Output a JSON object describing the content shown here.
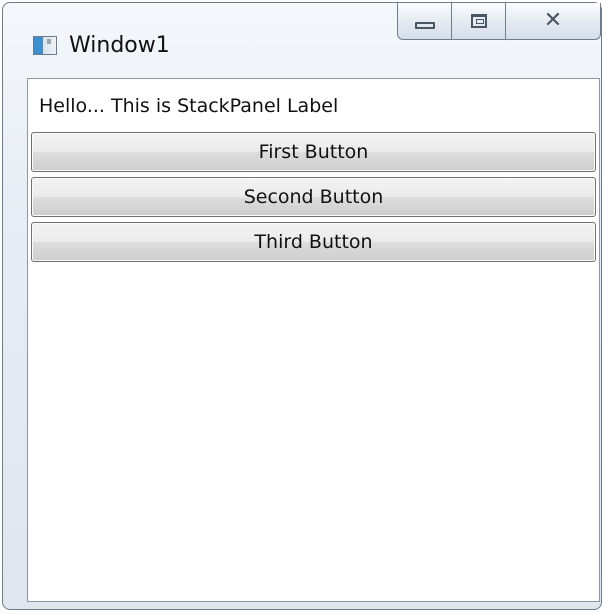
{
  "window": {
    "title": "Window1",
    "app_icon": "window-app-icon",
    "caption_buttons": {
      "minimize_icon": "minimize-icon",
      "maximize_icon": "maximize-icon",
      "close_icon": "close-icon",
      "close_glyph": "☒"
    }
  },
  "content": {
    "label": "Hello... This is StackPanel Label",
    "buttons": [
      {
        "label": "First Button"
      },
      {
        "label": "Second Button"
      },
      {
        "label": "Third Button"
      }
    ]
  }
}
